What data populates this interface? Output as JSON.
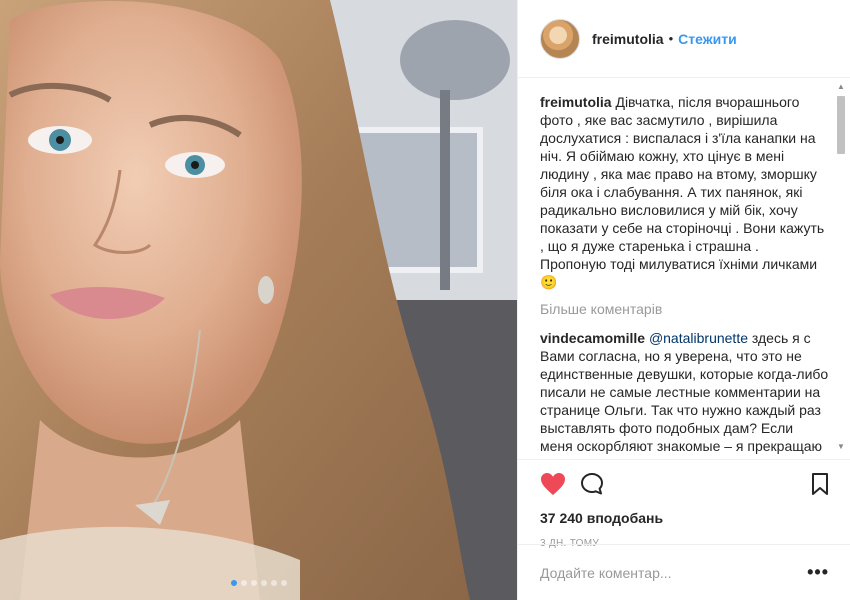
{
  "post": {
    "image_alt": "",
    "carousel": {
      "count": 6,
      "active_index": 0
    }
  },
  "header": {
    "username": "freimutolia",
    "separator": "•",
    "follow_label": "Стежити"
  },
  "caption": {
    "username": "freimutolia",
    "text": "Дівчатка, після вчорашнього фото , яке вас засмутило , вирішила дослухатися : виспалася і з'їла канапки на ніч. Я обіймаю кожну, хто цінує в мені людину , яка має право на втому, зморшку біля ока і слабування. А тих панянок, які радикально висловилися у мій бік, хочу показати у себе на сторіночці . Вони кажуть , що я дуже старенька і страшна . Пропоную тоді милуватися їхніми личками 🙂"
  },
  "load_more_label": "Більше коментарів",
  "comments": [
    {
      "username": "vindecamomille",
      "mention": "@natalibrunette",
      "text": " здесь я с Вами согласна, но я уверена, что это не единственные девушки, которые когда-либо писали не самые лестные комментарии на странице Ольги. Так что нужно каждый раз выставлять фото подобных дам? Если меня оскорбляют знакомые – я прекращаю общение, если"
    }
  ],
  "actions": {
    "like_icon": "heart-icon",
    "comment_icon": "comment-bubble-icon",
    "save_icon": "bookmark-icon",
    "likes_label": "37 240 вподобань",
    "time_label": "3 ДН. ТОМУ"
  },
  "add_comment": {
    "placeholder": "Додайте коментар...",
    "more_options": "•••"
  },
  "colors": {
    "accent": "#3897f0",
    "like": "#ed4956",
    "muted": "#999999"
  }
}
